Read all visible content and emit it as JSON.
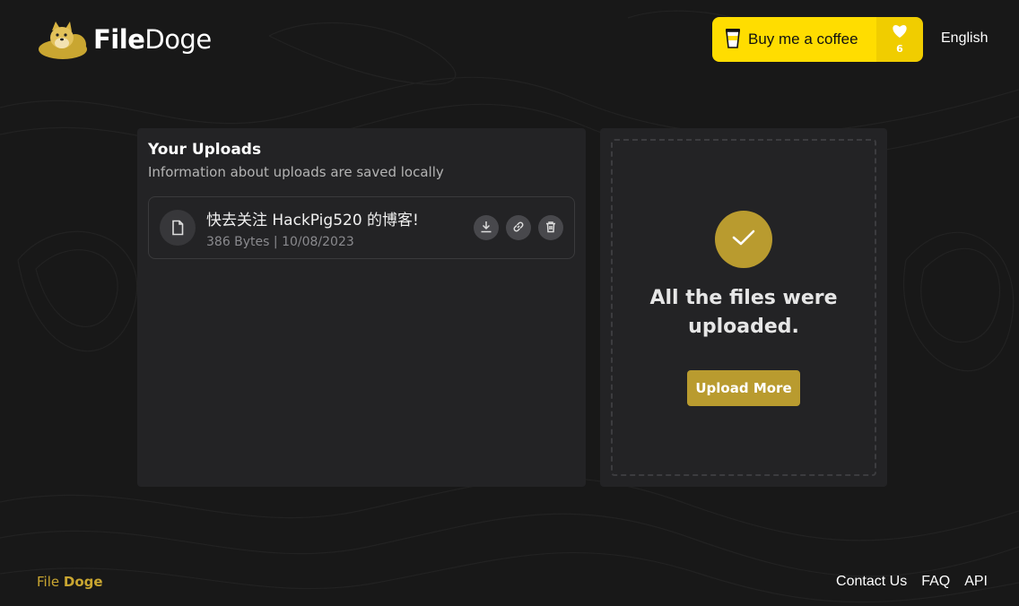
{
  "header": {
    "logo_name": "FileDoge",
    "logo_part1": "File",
    "logo_part2": "Doge",
    "coffee_label": "Buy me a coffee",
    "coffee_count": "6",
    "language": "English"
  },
  "uploads": {
    "title": "Your Uploads",
    "subtitle": "Information about uploads are saved locally",
    "files": [
      {
        "name": "快去关注 HackPig520 的博客!",
        "size": "386 Bytes",
        "date": "10/08/2023",
        "meta": "386 Bytes | 10/08/2023"
      }
    ]
  },
  "status": {
    "message": "All the files were uploaded.",
    "button": "Upload More"
  },
  "footer": {
    "brand_part1": "File",
    "brand_part2": "Doge",
    "links": [
      "Contact Us",
      "FAQ",
      "API"
    ]
  },
  "colors": {
    "accent": "#b99b2f",
    "coffee_yellow": "#ffdd00",
    "background": "#181818",
    "panel": "#232325"
  },
  "icons": [
    "doge-logo-icon",
    "coffee-cup-icon",
    "heart-icon",
    "file-icon",
    "download-icon",
    "link-icon",
    "trash-icon",
    "check-icon"
  ]
}
